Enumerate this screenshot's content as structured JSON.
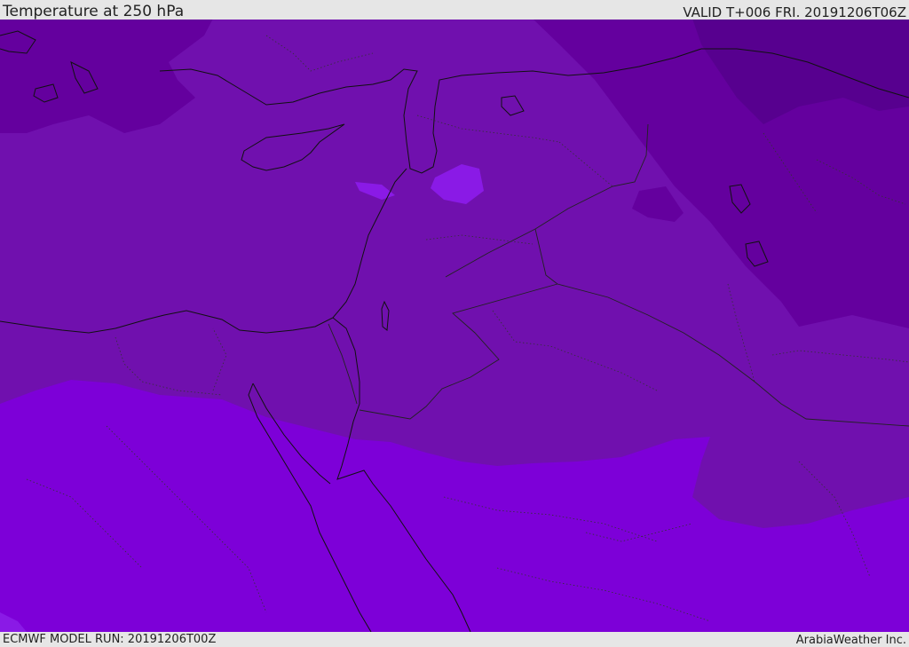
{
  "header": {
    "title": "Temperature at 250 hPa",
    "valid": "VALID T+006 FRI. 20191206T06Z"
  },
  "footer": {
    "model_run": "ECMWF MODEL RUN: 20191206T00Z",
    "credit": "ArabiaWeather Inc."
  },
  "colors": {
    "band_cold_dark": "#57008f",
    "band_cold": "#64009e",
    "band_mid": "#7010ae",
    "band_warm": "#7d00d8",
    "patch_light": "#8a1ae6",
    "coastline": "#111111",
    "borders": "#222222"
  },
  "map": {
    "field": "temperature",
    "level": "250 hPa"
  }
}
